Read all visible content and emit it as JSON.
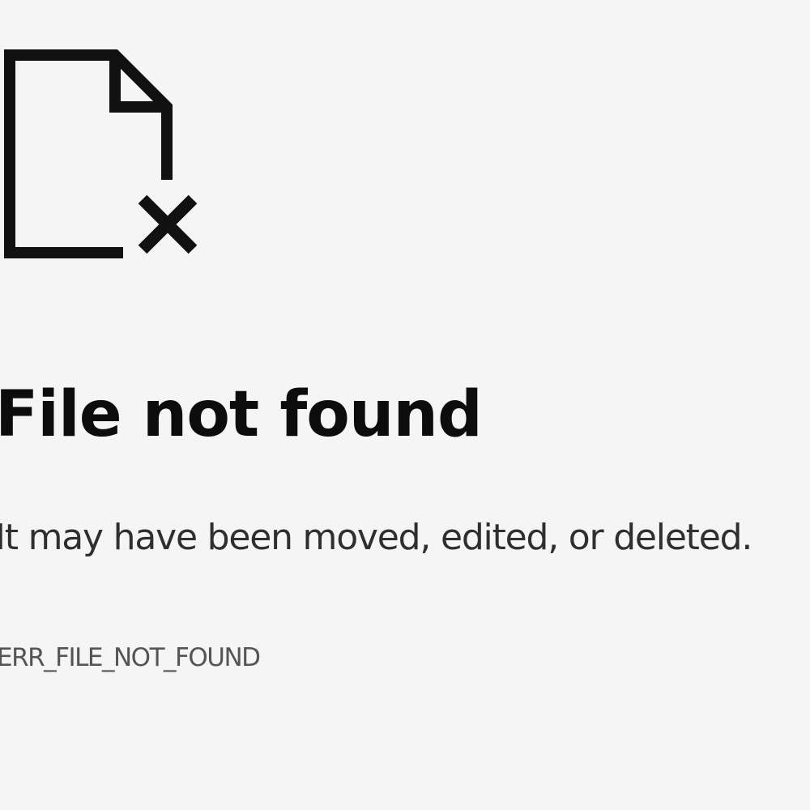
{
  "error_page": {
    "icon": "file-not-found-icon",
    "title": "File not found",
    "message": "It may have been moved, edited, or deleted.",
    "error_code": "ERR_FILE_NOT_FOUND"
  },
  "colors": {
    "background": "#f5f5f5",
    "title": "#0c0c0c",
    "message": "#2f2f2f",
    "error_code": "#555555",
    "icon": "#111111"
  }
}
